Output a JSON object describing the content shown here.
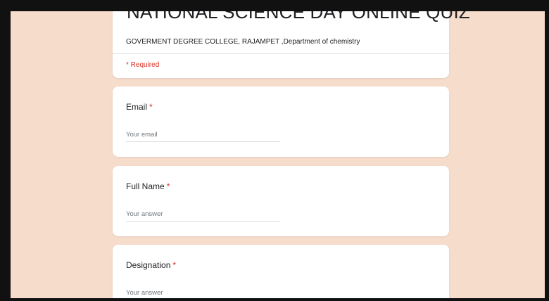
{
  "form": {
    "title": "NATIONAL SCIENCE DAY ONLINE QUIZ",
    "description": "GOVERMENT DEGREE COLLEGE, RAJAMPET ,Department of chemistry",
    "required_note": "* Required"
  },
  "questions": [
    {
      "label": "Email",
      "required_mark": "*",
      "placeholder": "Your email"
    },
    {
      "label": "Full Name",
      "required_mark": "*",
      "placeholder": "Your answer"
    },
    {
      "label": "Designation",
      "required_mark": "*",
      "placeholder": "Your answer"
    }
  ],
  "colors": {
    "page_background": "#f6dccb",
    "card_background": "#ffffff",
    "required_red": "#d93025",
    "frame_black": "#111111"
  }
}
